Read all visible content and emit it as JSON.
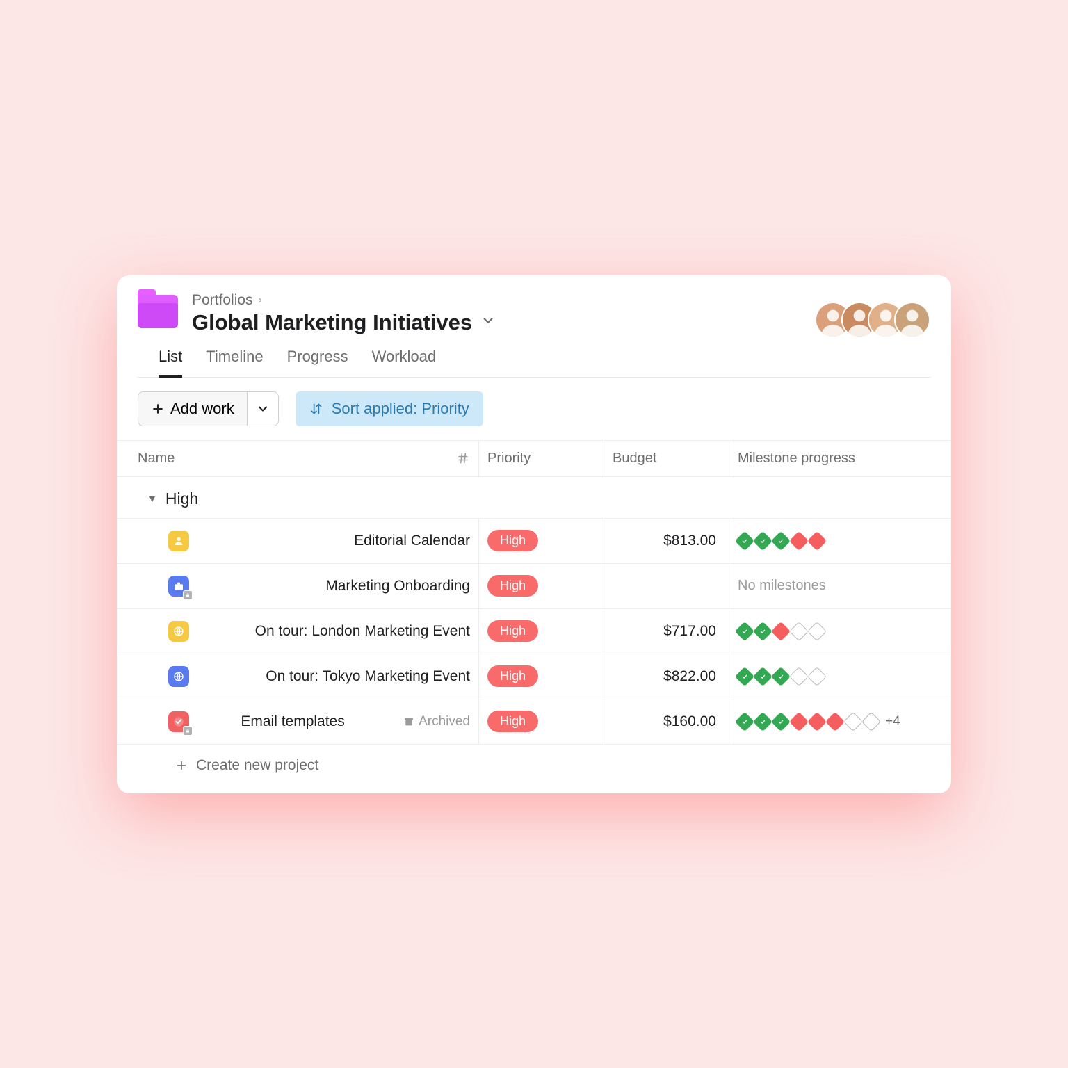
{
  "breadcrumb": {
    "root": "Portfolios"
  },
  "title": "Global Marketing Initiatives",
  "tabs": [
    {
      "label": "List",
      "active": true
    },
    {
      "label": "Timeline",
      "active": false
    },
    {
      "label": "Progress",
      "active": false
    },
    {
      "label": "Workload",
      "active": false
    }
  ],
  "toolbar": {
    "add_work_label": "Add work",
    "sort_label": "Sort applied: Priority"
  },
  "columns": {
    "name": "Name",
    "priority": "Priority",
    "budget": "Budget",
    "milestones": "Milestone progress"
  },
  "group": {
    "label": "High"
  },
  "priority_pill": "High",
  "create_label": "Create new project",
  "no_milestones_label": "No milestones",
  "rows": [
    {
      "name": "Editorial Calendar",
      "icon_color": "yellow",
      "icon_glyph": "user",
      "locked": false,
      "archived": false,
      "budget": "$813.00",
      "milestones": [
        "green",
        "green",
        "green",
        "red",
        "red"
      ],
      "more": null
    },
    {
      "name": "Marketing Onboarding",
      "icon_color": "blue",
      "icon_glyph": "briefcase",
      "locked": true,
      "archived": false,
      "budget": "",
      "milestones": null,
      "more": null
    },
    {
      "name": "On tour: London Marketing Event",
      "icon_color": "yellow",
      "icon_glyph": "globe",
      "locked": false,
      "archived": false,
      "budget": "$717.00",
      "milestones": [
        "green",
        "green",
        "red",
        "open",
        "open"
      ],
      "more": null
    },
    {
      "name": "On tour: Tokyo Marketing Event",
      "icon_color": "blue",
      "icon_glyph": "globe",
      "locked": false,
      "archived": false,
      "budget": "$822.00",
      "milestones": [
        "green",
        "green",
        "green",
        "open",
        "open"
      ],
      "more": null
    },
    {
      "name": "Email templates",
      "icon_color": "red",
      "icon_glyph": "check",
      "locked": true,
      "archived": true,
      "archived_label": "Archived",
      "budget": "$160.00",
      "milestones": [
        "green",
        "green",
        "green",
        "red",
        "red",
        "red",
        "open",
        "open"
      ],
      "more": "+4"
    }
  ],
  "avatar_colors": [
    "#d9a07b",
    "#c88a5e",
    "#e0b189",
    "#caa27a"
  ]
}
